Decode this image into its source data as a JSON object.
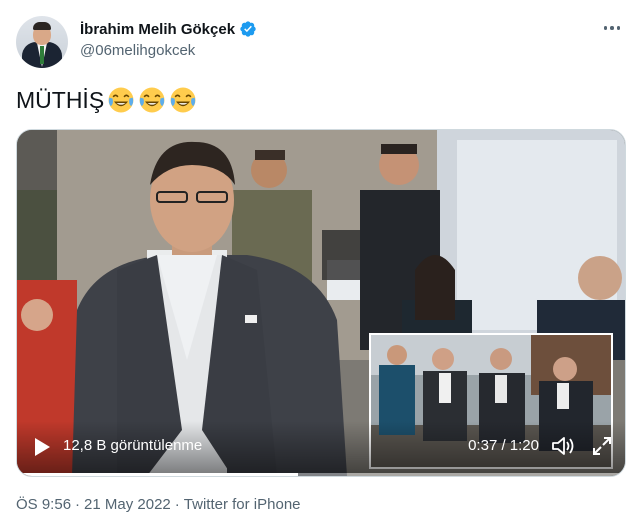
{
  "author": {
    "display_name": "İbrahim Melih Gökçek",
    "handle": "@06melihgokcek",
    "verified": true,
    "avatar_icon": "profile-photo"
  },
  "tweet": {
    "text": "MÜTHİŞ",
    "emojis": [
      "face-with-tears-of-joy",
      "face-with-tears-of-joy",
      "face-with-tears-of-joy"
    ]
  },
  "video": {
    "views": "12,8 B görüntülenme",
    "time": "0:37 / 1:20",
    "progress": 0.4625,
    "play_icon": "play-icon",
    "volume_icon": "volume-icon",
    "fullscreen_icon": "fullscreen-icon"
  },
  "footer": {
    "time": "ÖS 9:56",
    "sep1": "·",
    "date": "21 May 2022",
    "sep2": "·",
    "source": "Twitter for iPhone"
  },
  "colors": {
    "text_primary": "#0f1419",
    "text_secondary": "#536471",
    "verified_blue": "#1d9bf0",
    "border": "#cfd9de"
  }
}
